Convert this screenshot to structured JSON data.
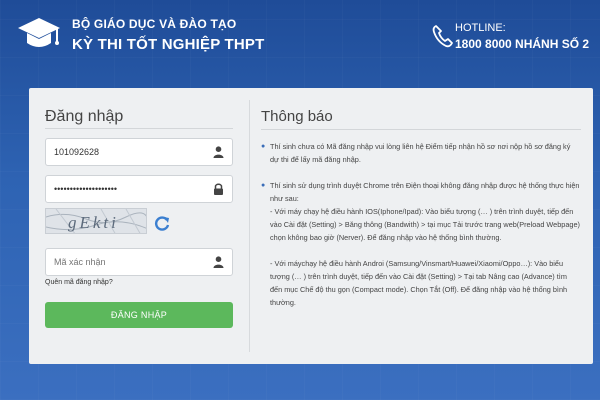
{
  "header": {
    "ministry": "BỘ GIÁO DỤC VÀ ĐÀO TẠO",
    "exam_title": "KỲ THI TỐT NGHIỆP THPT",
    "hotline_label": "HOTLINE:",
    "hotline_number": "1800 8000 NHÁNH SỐ 2"
  },
  "login": {
    "title": "Đăng nhập",
    "username_value": "101092628",
    "password_value": "••••••••••••••••••••",
    "captcha_text": "gEkti",
    "captcha_placeholder": "Mã xác nhận",
    "forgot_label": "Quên mã đăng nhập?",
    "submit_label": "ĐĂNG NHẬP"
  },
  "notice": {
    "title": "Thông báo",
    "items": [
      "Thí sinh chưa có Mã đăng nhập vui lòng liên hệ Điểm tiếp nhận hồ sơ nơi nộp hồ sơ đăng ký dự thi để lấy mã đăng nhập.",
      "Thí sinh sử dụng trình duyệt Chrome trên Điện thoại không đăng nhập được hệ thống thực hiện như sau:"
    ],
    "sub_items": [
      "- Với máy chạy hệ điều hành IOS(Iphone/Ipad): Vào biểu tượng (… ) trên trình duyệt, tiếp đến vào Cài đặt (Setting) > Băng thông (Bandwith) > tại mục Tải trước trang web(Preload Webpage) chọn không bao giờ (Nerver). Để đăng nhập vào hệ thống bình thường.",
      "- Với máychạy hệ điều hành Androi (Samsung/Vinsmart/Huawei/Xiaomi/Oppo…): Vào biểu tượng (… ) trên trình duyệt, tiếp đến vào Cài đặt (Setting) > Tại tab Nâng cao (Advance) tìm đến mục Chế độ thu gọn (Compact mode). Chọn Tắt (Off). Để đăng nhập vào hệ thống bình thường."
    ]
  },
  "colors": {
    "background": "#2d5aa3",
    "panel": "#eef0f2",
    "button": "#5cb85c",
    "bullet": "#3a6db8"
  }
}
